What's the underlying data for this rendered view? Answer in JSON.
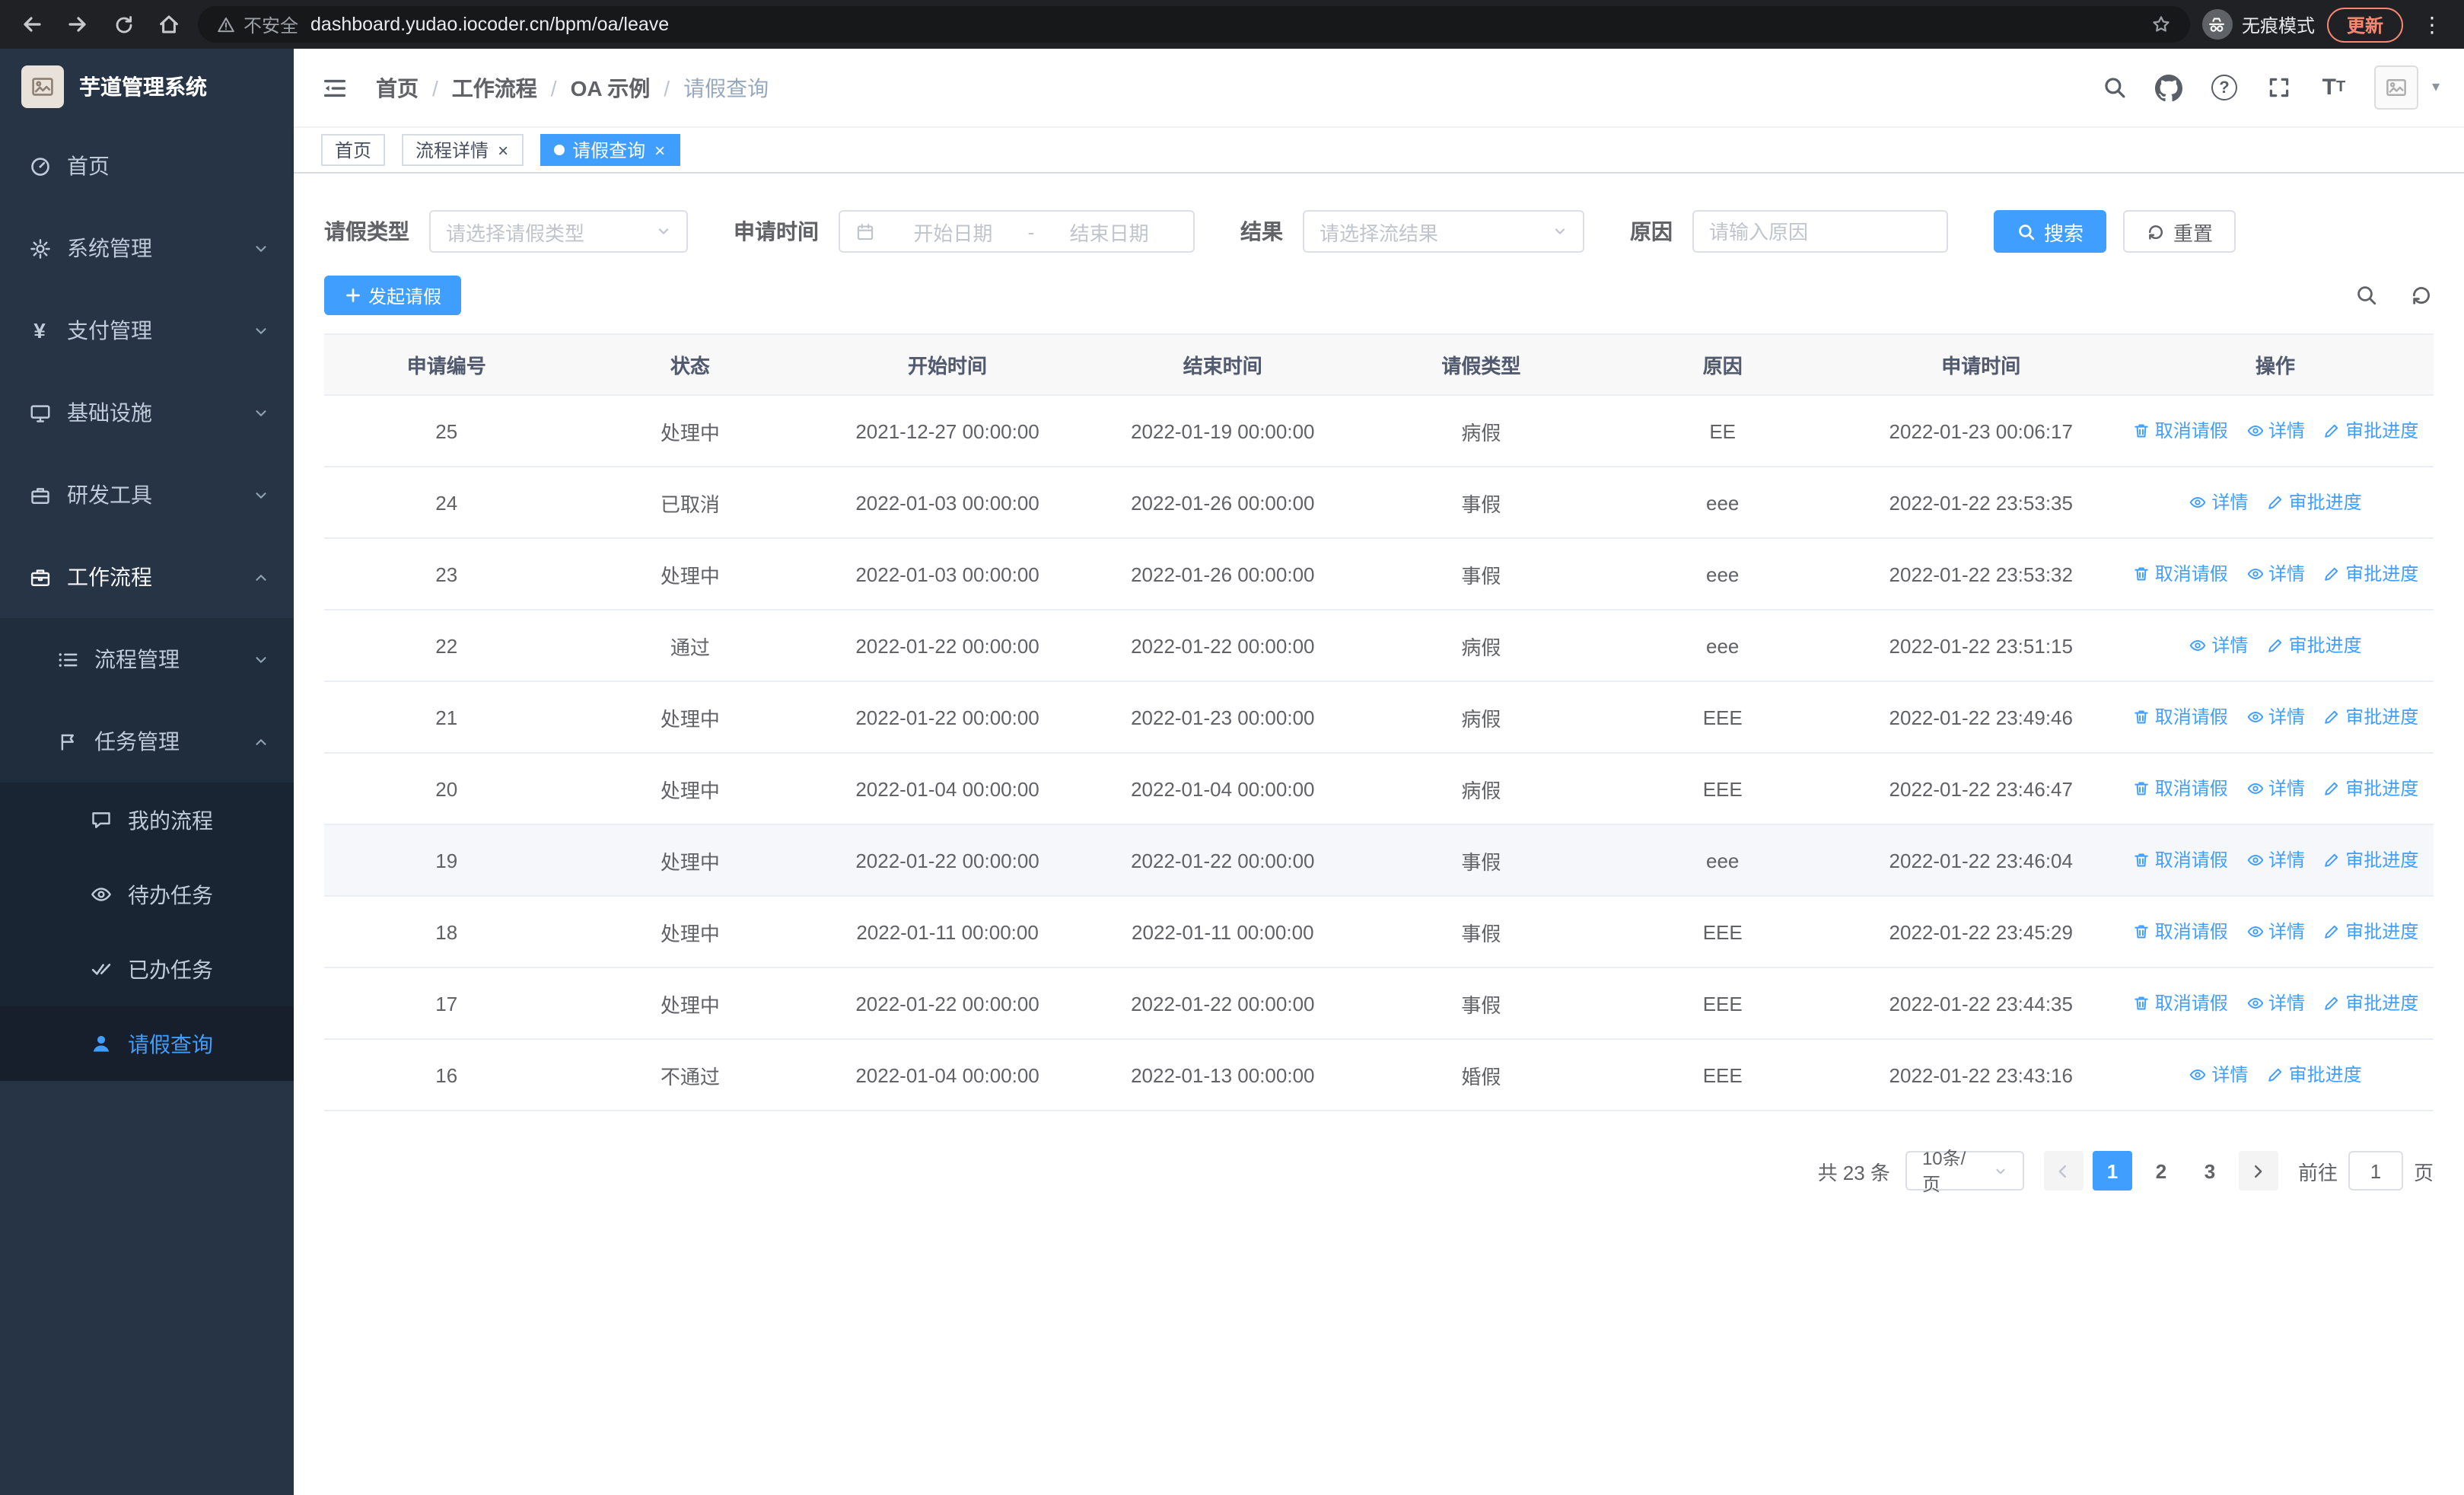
{
  "browser": {
    "security_label": "不安全",
    "url": "dashboard.yudao.iocoder.cn/bpm/oa/leave",
    "incognito_label": "无痕模式",
    "update_label": "更新"
  },
  "sidebar": {
    "logo_title": "芋道管理系统",
    "items": [
      {
        "label": "首页"
      },
      {
        "label": "系统管理"
      },
      {
        "label": "支付管理"
      },
      {
        "label": "基础设施"
      },
      {
        "label": "研发工具"
      },
      {
        "label": "工作流程"
      }
    ],
    "workflow_children": [
      {
        "label": "流程管理"
      },
      {
        "label": "任务管理"
      }
    ],
    "task_children": [
      {
        "label": "我的流程"
      },
      {
        "label": "待办任务"
      },
      {
        "label": "已办任务"
      },
      {
        "label": "请假查询"
      }
    ]
  },
  "header": {
    "breadcrumb": [
      "首页",
      "工作流程",
      "OA 示例",
      "请假查询"
    ],
    "separator": "/"
  },
  "tabs": [
    {
      "label": "首页",
      "closable": false,
      "active": false
    },
    {
      "label": "流程详情",
      "closable": true,
      "active": false
    },
    {
      "label": "请假查询",
      "closable": true,
      "active": true
    }
  ],
  "filters": {
    "leave_type_label": "请假类型",
    "leave_type_placeholder": "请选择请假类型",
    "apply_time_label": "申请时间",
    "start_date_placeholder": "开始日期",
    "end_date_placeholder": "结束日期",
    "range_separator": "-",
    "result_label": "结果",
    "result_placeholder": "请选择流结果",
    "reason_label": "原因",
    "reason_placeholder": "请输入原因",
    "search_label": "搜索",
    "reset_label": "重置"
  },
  "toolbar": {
    "create_label": "发起请假"
  },
  "table": {
    "columns": [
      "申请编号",
      "状态",
      "开始时间",
      "结束时间",
      "请假类型",
      "原因",
      "申请时间",
      "操作"
    ],
    "action_labels": {
      "cancel": "取消请假",
      "detail": "详情",
      "progress": "审批进度"
    },
    "rows": [
      {
        "id": "25",
        "status": "处理中",
        "start_time": "2021-12-27 00:00:00",
        "end_time": "2022-01-19 00:00:00",
        "leave_type": "病假",
        "reason": "EE",
        "apply_time": "2022-01-23 00:06:17",
        "can_cancel": true,
        "highlighted": false
      },
      {
        "id": "24",
        "status": "已取消",
        "start_time": "2022-01-03 00:00:00",
        "end_time": "2022-01-26 00:00:00",
        "leave_type": "事假",
        "reason": "eee",
        "apply_time": "2022-01-22 23:53:35",
        "can_cancel": false,
        "highlighted": false
      },
      {
        "id": "23",
        "status": "处理中",
        "start_time": "2022-01-03 00:00:00",
        "end_time": "2022-01-26 00:00:00",
        "leave_type": "事假",
        "reason": "eee",
        "apply_time": "2022-01-22 23:53:32",
        "can_cancel": true,
        "highlighted": false
      },
      {
        "id": "22",
        "status": "通过",
        "start_time": "2022-01-22 00:00:00",
        "end_time": "2022-01-22 00:00:00",
        "leave_type": "病假",
        "reason": "eee",
        "apply_time": "2022-01-22 23:51:15",
        "can_cancel": false,
        "highlighted": false
      },
      {
        "id": "21",
        "status": "处理中",
        "start_time": "2022-01-22 00:00:00",
        "end_time": "2022-01-23 00:00:00",
        "leave_type": "病假",
        "reason": "EEE",
        "apply_time": "2022-01-22 23:49:46",
        "can_cancel": true,
        "highlighted": false
      },
      {
        "id": "20",
        "status": "处理中",
        "start_time": "2022-01-04 00:00:00",
        "end_time": "2022-01-04 00:00:00",
        "leave_type": "病假",
        "reason": "EEE",
        "apply_time": "2022-01-22 23:46:47",
        "can_cancel": true,
        "highlighted": false
      },
      {
        "id": "19",
        "status": "处理中",
        "start_time": "2022-01-22 00:00:00",
        "end_time": "2022-01-22 00:00:00",
        "leave_type": "事假",
        "reason": "eee",
        "apply_time": "2022-01-22 23:46:04",
        "can_cancel": true,
        "highlighted": true
      },
      {
        "id": "18",
        "status": "处理中",
        "start_time": "2022-01-11 00:00:00",
        "end_time": "2022-01-11 00:00:00",
        "leave_type": "事假",
        "reason": "EEE",
        "apply_time": "2022-01-22 23:45:29",
        "can_cancel": true,
        "highlighted": false
      },
      {
        "id": "17",
        "status": "处理中",
        "start_time": "2022-01-22 00:00:00",
        "end_time": "2022-01-22 00:00:00",
        "leave_type": "事假",
        "reason": "EEE",
        "apply_time": "2022-01-22 23:44:35",
        "can_cancel": true,
        "highlighted": false
      },
      {
        "id": "16",
        "status": "不通过",
        "start_time": "2022-01-04 00:00:00",
        "end_time": "2022-01-13 00:00:00",
        "leave_type": "婚假",
        "reason": "EEE",
        "apply_time": "2022-01-22 23:43:16",
        "can_cancel": false,
        "highlighted": false
      }
    ]
  },
  "pagination": {
    "total_text": "共 23 条",
    "page_size_label": "10条/页",
    "pages": [
      "1",
      "2",
      "3"
    ],
    "active_page": "1",
    "goto_label": "前往",
    "goto_value": "1",
    "unit_label": "页"
  },
  "colors": {
    "primary": "#409eff",
    "sidebar_bg": "#263445",
    "submenu_bg": "#1f2d3d",
    "table_header_bg": "#f8f8f9"
  }
}
